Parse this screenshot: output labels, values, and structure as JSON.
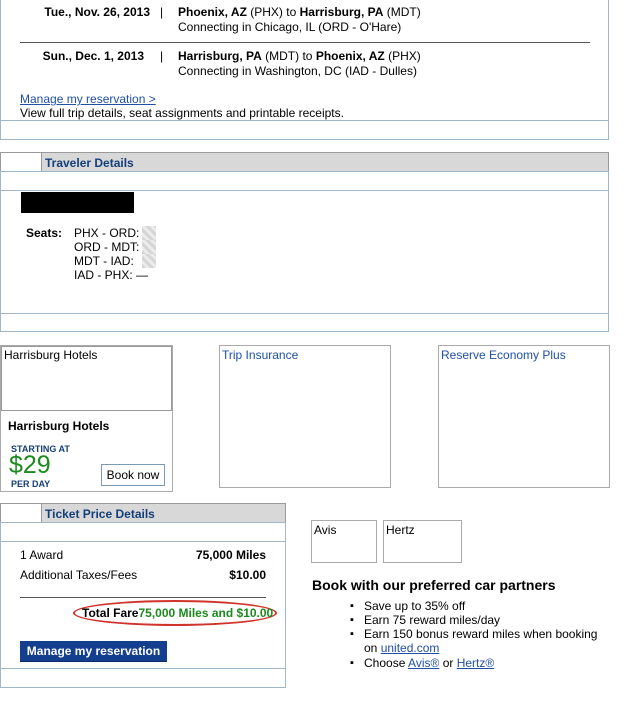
{
  "itinerary": {
    "flights": [
      {
        "date": "Tue., Nov. 26, 2013",
        "sep": "|",
        "from_city": "Phoenix, AZ",
        "from_code": "(PHX)",
        "to_word": "to",
        "to_city": "Harrisburg, PA",
        "to_code": "(MDT)",
        "connecting": "Connecting in Chicago, IL (ORD - O'Hare)"
      },
      {
        "date": "Sun., Dec. 1, 2013",
        "sep": "|",
        "from_city": "Harrisburg, PA",
        "from_code": "(MDT)",
        "to_word": "to",
        "to_city": "Phoenix, AZ",
        "to_code": "(PHX)",
        "connecting": "Connecting in Washington, DC (IAD - Dulles)"
      }
    ],
    "manage_link": "Manage my reservation >",
    "manage_desc": "View full trip details, seat assignments and printable receipts."
  },
  "traveler": {
    "header": "Traveler Details",
    "seats_label": "Seats:",
    "seats": [
      "PHX - ORD:",
      "ORD - MDT:",
      "MDT - IAD:",
      "IAD - PHX: —"
    ]
  },
  "ads": {
    "hotels_img_label": "Harrisburg Hotels",
    "hotels_title": "Harrisburg Hotels",
    "starting_at": "STARTING AT",
    "price": "$29",
    "per_day": "PER DAY",
    "book_now": "Book now",
    "trip_insurance": "Trip Insurance",
    "economy_plus": "Reserve Economy Plus"
  },
  "price": {
    "header": "Ticket Price Details",
    "rows": [
      {
        "label": "1 Award",
        "value": "75,000 Miles"
      },
      {
        "label": "Additional Taxes/Fees",
        "value": "$10.00"
      }
    ],
    "total_label": "Total Fare",
    "total_value": "75,000 Miles and $10.00",
    "manage_button": "Manage my reservation"
  },
  "cars": {
    "avis": "Avis",
    "hertz": "Hertz",
    "heading": "Book with our preferred car partners",
    "bullets": [
      "Save up to 35% off",
      "Earn 75 reward miles/day",
      "Earn 150 bonus reward miles when booking"
    ],
    "on_text": "on",
    "united_link": "united.com",
    "choose_text": "Choose",
    "avis_link": "Avis®",
    "or_text": "or",
    "hertz_link": "Hertz®"
  },
  "colors": {
    "header_text": "#143f7a",
    "link": "#1f4fa6",
    "green": "#1c8a1c",
    "button": "#143f8f",
    "highlight": "#d0342c"
  }
}
